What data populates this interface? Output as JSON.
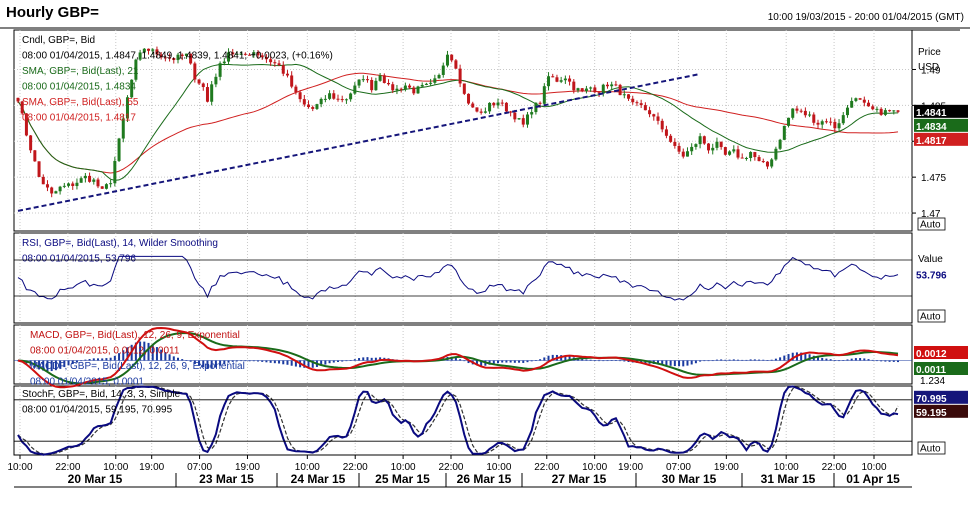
{
  "header": {
    "title": "Hourly GBP=",
    "date_range": "10:00 19/03/2015 - 20:00 01/04/2015 (GMT)"
  },
  "right_axis": {
    "price_label": "Price",
    "currency_label": "USD",
    "value_label": "Value",
    "auto_label": "Auto"
  },
  "colors": {
    "background": "#ffffff",
    "candle_up": "#1f7a1f",
    "candle_down": "#c0161b",
    "sma21": "#1a6b1a",
    "sma55": "#d02020",
    "trendline": "#15157a",
    "rsi": "#0a0a80",
    "macd": "#d01010",
    "macd_signal": "#1a6b1a",
    "macd_hist": "#1a3aa0",
    "stoch_k": "#0a0a80",
    "stoch_d": "#333333"
  },
  "chart_data": [
    {
      "type": "candlestick",
      "panel": "price",
      "legend": [
        {
          "text": "Cndl, GBP=, Bid",
          "color": "#000000"
        },
        {
          "text": "08:00 01/04/2015, 1.4847, 1.4849, 1.4839, 1.4841, +0.0023, (+0.16%)",
          "color": "#000000",
          "highlight": "+0.0023, (+0.16%)",
          "highlight_color": "#1f1fb0"
        },
        {
          "text": "SMA, GBP=, Bid(Last), 21",
          "color": "#1a6b1a"
        },
        {
          "text": "08:00 01/04/2015, 1.4834",
          "color": "#1a6b1a"
        },
        {
          "text": "SMA, GBP=, Bid(Last), 55",
          "color": "#d02020"
        },
        {
          "text": "08:00 01/04/2015, 1.4817",
          "color": "#d02020"
        }
      ],
      "y_ticks": [
        "1.49",
        "1.485",
        "1.48",
        "1.475",
        "1.47"
      ],
      "ylim": [
        1.4675,
        1.4955
      ],
      "last_values": {
        "close": "1.4841",
        "sma21": "1.4834",
        "sma55": "1.4817"
      },
      "anchors_close": [
        [
          0,
          1.486
        ],
        [
          2,
          1.481
        ],
        [
          5,
          1.475
        ],
        [
          8,
          1.4725
        ],
        [
          10,
          1.4735
        ],
        [
          13,
          1.474
        ],
        [
          16,
          1.475
        ],
        [
          18,
          1.4745
        ],
        [
          20,
          1.473
        ],
        [
          22,
          1.4745
        ],
        [
          24,
          1.48
        ],
        [
          26,
          1.486
        ],
        [
          28,
          1.491
        ],
        [
          30,
          1.493
        ],
        [
          32,
          1.4925
        ],
        [
          34,
          1.492
        ],
        [
          37,
          1.4915
        ],
        [
          40,
          1.492
        ],
        [
          42,
          1.489
        ],
        [
          44,
          1.4875
        ],
        [
          45,
          1.4855
        ],
        [
          46,
          1.488
        ],
        [
          48,
          1.4905
        ],
        [
          50,
          1.4925
        ],
        [
          53,
          1.4918
        ],
        [
          56,
          1.4925
        ],
        [
          59,
          1.4915
        ],
        [
          62,
          1.4905
        ],
        [
          64,
          1.4888
        ],
        [
          66,
          1.4865
        ],
        [
          68,
          1.485
        ],
        [
          70,
          1.4845
        ],
        [
          72,
          1.4855
        ],
        [
          74,
          1.4865
        ],
        [
          76,
          1.4858
        ],
        [
          78,
          1.486
        ],
        [
          80,
          1.4875
        ],
        [
          82,
          1.489
        ],
        [
          84,
          1.4875
        ],
        [
          86,
          1.4895
        ],
        [
          88,
          1.4875
        ],
        [
          90,
          1.4872
        ],
        [
          92,
          1.4878
        ],
        [
          94,
          1.487
        ],
        [
          96,
          1.4875
        ],
        [
          98,
          1.4878
        ],
        [
          100,
          1.489
        ],
        [
          102,
          1.4925
        ],
        [
          104,
          1.4905
        ],
        [
          106,
          1.4865
        ],
        [
          108,
          1.4845
        ],
        [
          110,
          1.4838
        ],
        [
          112,
          1.485
        ],
        [
          114,
          1.4855
        ],
        [
          116,
          1.4845
        ],
        [
          118,
          1.4835
        ],
        [
          120,
          1.4822
        ],
        [
          122,
          1.4845
        ],
        [
          124,
          1.4855
        ],
        [
          126,
          1.489
        ],
        [
          128,
          1.4885
        ],
        [
          130,
          1.489
        ],
        [
          132,
          1.4875
        ],
        [
          134,
          1.4868
        ],
        [
          136,
          1.4875
        ],
        [
          138,
          1.487
        ],
        [
          140,
          1.488
        ],
        [
          142,
          1.4875
        ],
        [
          144,
          1.4862
        ],
        [
          146,
          1.485
        ],
        [
          148,
          1.4848
        ],
        [
          150,
          1.484
        ],
        [
          152,
          1.4825
        ],
        [
          154,
          1.481
        ],
        [
          156,
          1.479
        ],
        [
          158,
          1.478
        ],
        [
          160,
          1.479
        ],
        [
          162,
          1.4805
        ],
        [
          164,
          1.479
        ],
        [
          166,
          1.4795
        ],
        [
          168,
          1.478
        ],
        [
          170,
          1.4785
        ],
        [
          172,
          1.4775
        ],
        [
          174,
          1.4785
        ],
        [
          176,
          1.477
        ],
        [
          178,
          1.4765
        ],
        [
          180,
          1.479
        ],
        [
          182,
          1.482
        ],
        [
          184,
          1.4845
        ],
        [
          186,
          1.484
        ],
        [
          188,
          1.4835
        ],
        [
          190,
          1.4825
        ],
        [
          192,
          1.483
        ],
        [
          194,
          1.482
        ],
        [
          196,
          1.4835
        ],
        [
          198,
          1.486
        ],
        [
          200,
          1.4855
        ],
        [
          202,
          1.4845
        ],
        [
          204,
          1.4841
        ]
      ],
      "trendline": {
        "from": [
          0,
          1.4703
        ],
        "to": [
          220,
          1.4962
        ]
      }
    },
    {
      "type": "line",
      "panel": "rsi",
      "legend": [
        {
          "text": "RSI, GBP=, Bid(Last), 14, Wilder Smoothing",
          "color": "#0a0a80"
        },
        {
          "text": "08:00 01/04/2015, 53.796",
          "color": "#0a0a80"
        }
      ],
      "ylim": [
        0,
        100
      ],
      "levels": [
        70,
        30
      ],
      "last_value": "53.796"
    },
    {
      "type": "line",
      "panel": "macd",
      "legend": [
        {
          "text": "MACD, GBP=, Bid(Last), 12, 26, 9, Exponential",
          "color": "#c01010"
        },
        {
          "text": "08:00 01/04/2015, 0.0012, 0.0011",
          "color": "#c01010"
        },
        {
          "text": "MACDF, GBP=, Bid(Last), 12, 26, 9, Exponential",
          "color": "#1a3aa0"
        },
        {
          "text": "08:00 01/04/2015, 0.0001",
          "color": "#1a3aa0"
        }
      ],
      "last_values": {
        "macd": "0.0012",
        "signal": "0.0011",
        "hidden": "1.234"
      }
    },
    {
      "type": "line",
      "panel": "stochastic",
      "legend": [
        {
          "text": "StochF, GBP=, Bid, 14, 3, 3, Simple",
          "color": "#000000"
        },
        {
          "text": "08:00 01/04/2015, 59.195, 70.995",
          "color": "#000000"
        }
      ],
      "ylim": [
        0,
        100
      ],
      "levels": [
        80,
        20
      ],
      "last_values": {
        "k": "59.195",
        "d": "70.995"
      }
    }
  ],
  "x_axis": {
    "hours": [
      "10:00",
      "22:00",
      "10:00",
      "19:00",
      "07:00",
      "19:00",
      "10:00",
      "22:00",
      "10:00",
      "22:00",
      "10:00",
      "22:00",
      "10:00",
      "19:00",
      "07:00",
      "19:00",
      "10:00",
      "22:00",
      "10:00"
    ],
    "days": [
      "20 Mar 15",
      "23 Mar 15",
      "24 Mar 15",
      "25 Mar 15",
      "26 Mar 15",
      "27 Mar 15",
      "30 Mar 15",
      "31 Mar 15",
      "01 Apr 15"
    ]
  }
}
